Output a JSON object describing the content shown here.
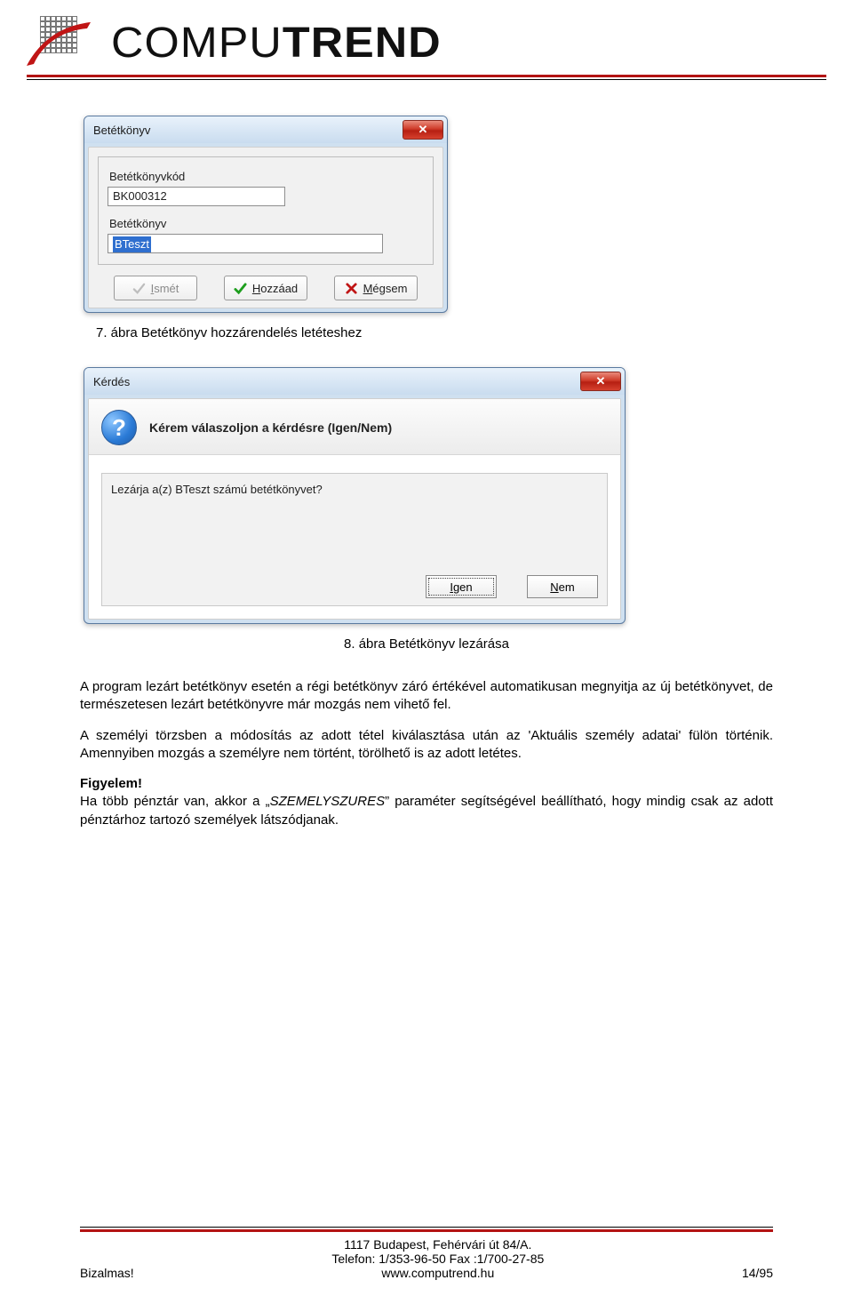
{
  "brand": {
    "part1": "COMPU",
    "part2": "TREND"
  },
  "dialog1": {
    "title": "Betétkönyv",
    "field_code_label": "Betétkönyvkód",
    "field_code_value": "BK000312",
    "field_name_label": "Betétkönyv",
    "field_name_value": "BTeszt",
    "btn_repeat": "Ismét",
    "btn_add": "Hozzáad",
    "btn_cancel": "Mégsem"
  },
  "caption1": "7. ábra Betétkönyv hozzárendelés letéteshez",
  "dialog2": {
    "title": "Kérdés",
    "heading": "Kérem válaszoljon a kérdésre (Igen/Nem)",
    "message": "Lezárja a(z) BTeszt számú betétkönyvet?",
    "btn_yes": "Igen",
    "btn_no": "Nem"
  },
  "caption2": "8. ábra Betétkönyv lezárása",
  "para1": "A program lezárt betétkönyv esetén a régi betétkönyv záró értékével automatikusan megnyitja az új betétkönyvet, de természetesen lezárt betétkönyvre már mozgás nem vihető fel.",
  "para2": "A személyi törzsben a módosítás az adott tétel kiválasztása után az 'Aktuális személy adatai' fülön történik. Amennyiben mozgás a személyre nem történt, törölhető is az adott letétes.",
  "alert_label": "Figyelem!",
  "para3_a": "Ha több pénztár van, akkor a „",
  "para3_param": "SZEMELYSZURES",
  "para3_b": "” paraméter segítségével beállítható, hogy mindig csak az adott pénztárhoz tartozó személyek látszódjanak.",
  "footer": {
    "left": "Bizalmas!",
    "line1": "1117 Budapest, Fehérvári út 84/A.",
    "line2": "Telefon: 1/353-96-50   Fax :1/700-27-85",
    "line3": "www.computrend.hu",
    "right": "14/95"
  }
}
